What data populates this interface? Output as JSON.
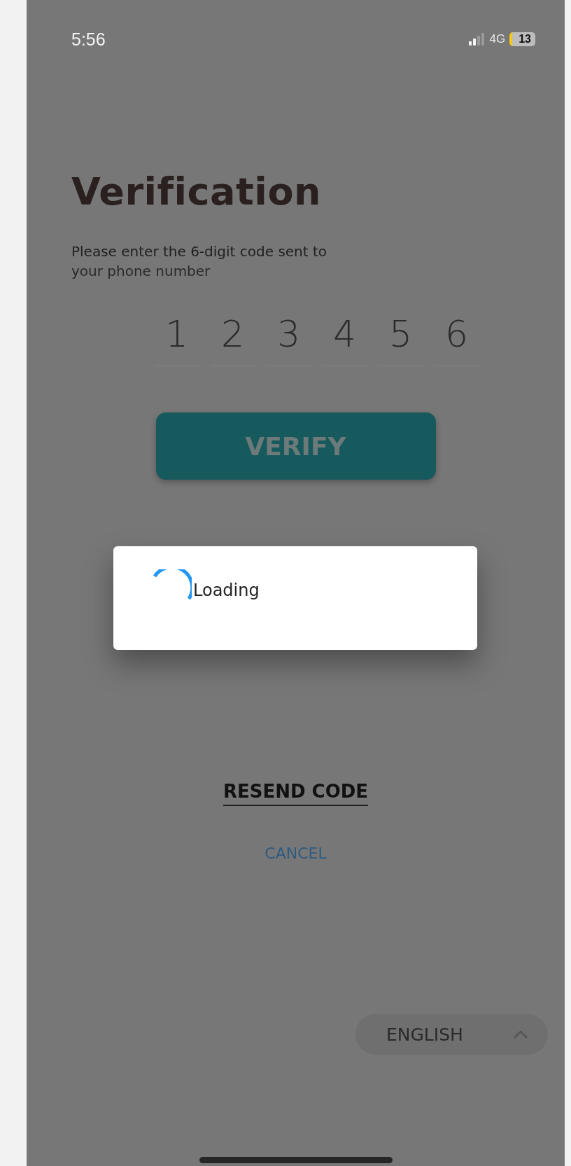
{
  "status_bar": {
    "time": "5:56",
    "network": "4G",
    "battery": "13"
  },
  "title": "Verification",
  "subtitle": "Please enter the 6-digit code sent to",
  "subtitle_2": "your phone number",
  "code": {
    "digits": [
      "1",
      "2",
      "3",
      "4",
      "5",
      "6"
    ]
  },
  "verify_button": {
    "label": "VERIFY",
    "disabled": true
  },
  "dialog": {
    "message": "Loading"
  },
  "resend_link": "RESEND CODE",
  "cancel_link": "CANCEL",
  "language_selector": {
    "label": "ENGLISH",
    "expanded": true
  }
}
